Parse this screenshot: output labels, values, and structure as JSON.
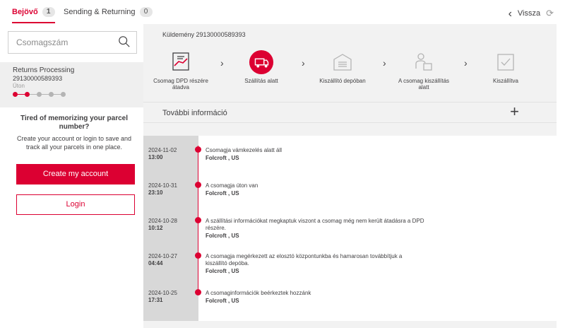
{
  "tabs": [
    {
      "label": "Bejövő",
      "count": "1"
    },
    {
      "label": "Sending & Returning",
      "count": "0"
    }
  ],
  "header": {
    "back_label": "Vissza"
  },
  "sidebar": {
    "search_placeholder": "Csomagszám",
    "card": {
      "title": "Returns Processing",
      "number": "29130000589393",
      "status": "Úton",
      "progress_step": 2,
      "progress_total": 5
    },
    "promo_title": "Tired of memorizing your parcel number?",
    "promo_text": "Create your account or login to save and track all your parcels in one place.",
    "create_label": "Create my account",
    "login_label": "Login"
  },
  "main": {
    "shipment_label": "Küldemény 29130000589393",
    "steps": [
      {
        "label": "Csomag DPD részére átadva",
        "icon": "handover-icon",
        "state": "done"
      },
      {
        "label": "Szállítás alatt",
        "icon": "truck-icon",
        "state": "active"
      },
      {
        "label": "Kiszállító depóban",
        "icon": "depot-icon",
        "state": "pending"
      },
      {
        "label": "A csomag kiszállítás alatt",
        "icon": "courier-icon",
        "state": "pending"
      },
      {
        "label": "Kiszállítva",
        "icon": "delivered-icon",
        "state": "pending"
      }
    ],
    "more_info_label": "További információ",
    "events": [
      {
        "date": "2024-11-02",
        "time": "13:00",
        "text": "Csomagja vámkezelés alatt áll",
        "location": "Folcroft , US"
      },
      {
        "date": "2024-10-31",
        "time": "23:10",
        "text": "A csomagja úton van",
        "location": "Folcroft , US"
      },
      {
        "date": "2024-10-28",
        "time": "10:12",
        "text": "A szállítási információkat megkaptuk viszont a csomag még nem került átadásra a DPD részére.",
        "location": "Folcroft , US"
      },
      {
        "date": "2024-10-27",
        "time": "04:44",
        "text": "A csomagja megérkezett az elosztó központunkba és hamarosan továbbítjuk a kiszállító depóba.",
        "location": "Folcroft , US"
      },
      {
        "date": "2024-10-25",
        "time": "17:31",
        "text": "A csomaginformációk beérkeztek hozzánk",
        "location": "Folcroft , US"
      }
    ]
  },
  "colors": {
    "accent": "#dc0032",
    "panel": "#f2f2f2",
    "date_column": "#d8d8d8",
    "muted": "#b4b4b4"
  }
}
